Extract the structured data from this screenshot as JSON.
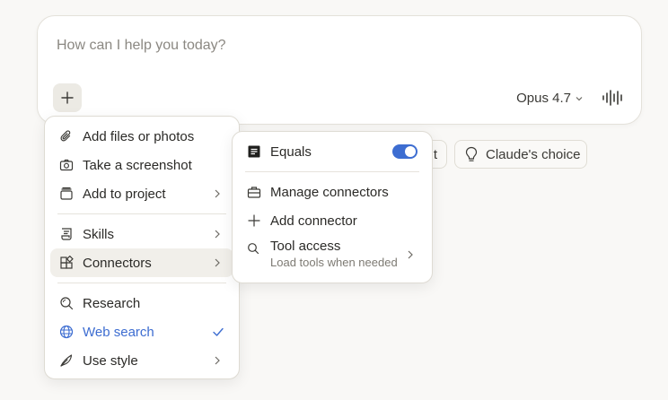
{
  "composer": {
    "placeholder": "How can I help you today?",
    "model": "Opus 4.7"
  },
  "chips": {
    "partial_label": "t",
    "choice_label": "Claude's choice"
  },
  "main_menu": {
    "items": [
      {
        "label": "Add files or photos",
        "icon": "paperclip-icon"
      },
      {
        "label": "Take a screenshot",
        "icon": "camera-icon"
      },
      {
        "label": "Add to project",
        "icon": "project-icon"
      },
      {
        "label": "Skills",
        "icon": "skills-icon"
      },
      {
        "label": "Connectors",
        "icon": "connectors-icon"
      },
      {
        "label": "Research",
        "icon": "research-icon"
      },
      {
        "label": "Web search",
        "icon": "globe-icon"
      },
      {
        "label": "Use style",
        "icon": "feather-icon"
      }
    ]
  },
  "connectors_menu": {
    "equals_label": "Equals",
    "equals_enabled": true,
    "manage_label": "Manage connectors",
    "add_label": "Add connector",
    "tool_access_label": "Tool access",
    "tool_access_sub": "Load tools when needed"
  },
  "colors": {
    "accent": "#3d6dd1",
    "background": "#f9f8f6"
  }
}
